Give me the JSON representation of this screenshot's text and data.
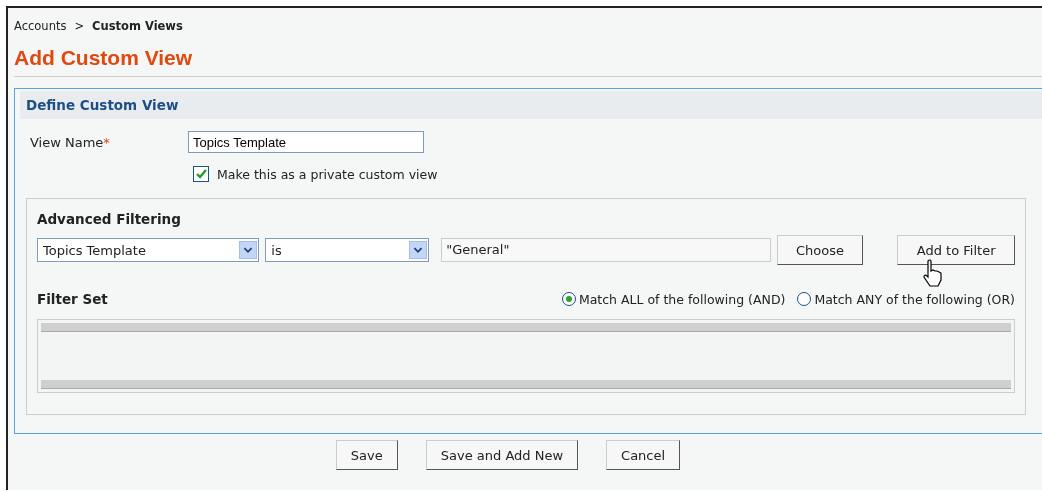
{
  "breadcrumb": {
    "separator": ">",
    "items": [
      {
        "label": "Accounts",
        "current": false
      },
      {
        "label": "Custom Views",
        "current": true
      }
    ]
  },
  "title": "Add Custom View",
  "define_section": {
    "heading": "Define Custom View",
    "view_name": {
      "label": "View Name",
      "required_mark": "*",
      "value": "Topics Template"
    },
    "private_checkbox": {
      "label": "Make this as a private custom view",
      "checked": true
    }
  },
  "advanced_filtering": {
    "heading": "Advanced Filtering",
    "field_select": "Topics Template",
    "operator_select": "is",
    "value": "\"General\"",
    "choose_button": "Choose",
    "add_button": "Add to Filter"
  },
  "filter_set": {
    "heading": "Filter Set",
    "match_options": [
      {
        "label": "Match ALL of the following (AND)",
        "selected": true
      },
      {
        "label": "Match ANY of the following (OR)",
        "selected": false
      }
    ]
  },
  "buttons": [
    "Save",
    "Save and Add New",
    "Cancel"
  ]
}
